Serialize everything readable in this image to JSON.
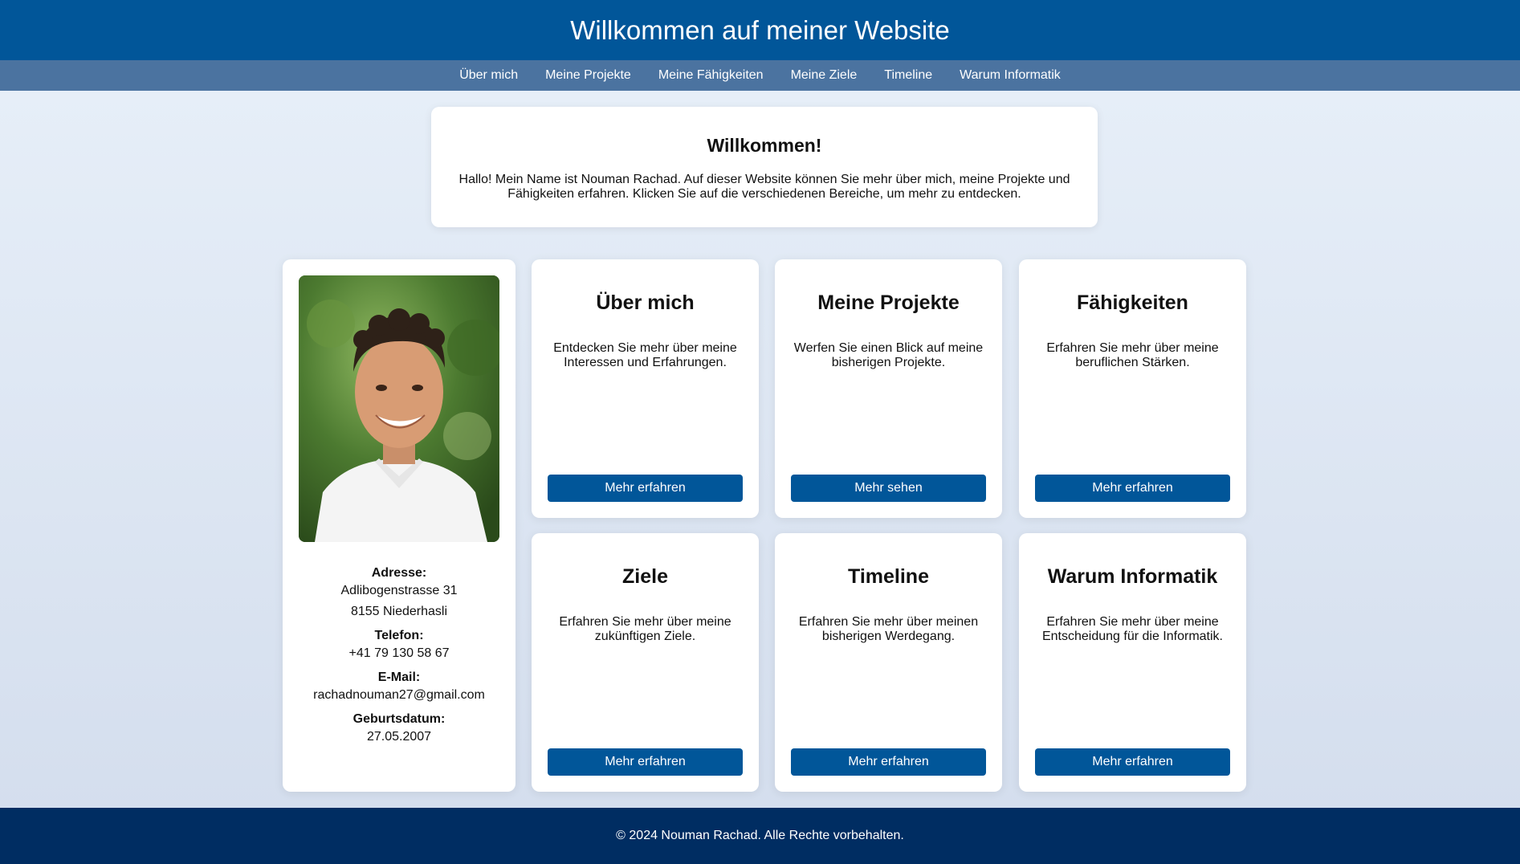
{
  "header": {
    "title": "Willkommen auf meiner Website"
  },
  "nav": {
    "items": [
      {
        "label": "Über mich"
      },
      {
        "label": "Meine Projekte"
      },
      {
        "label": "Meine Fähigkeiten"
      },
      {
        "label": "Meine Ziele"
      },
      {
        "label": "Timeline"
      },
      {
        "label": "Warum Informatik"
      }
    ]
  },
  "welcome": {
    "title": "Willkommen!",
    "text": "Hallo! Mein Name ist Nouman Rachad. Auf dieser Website können Sie mehr über mich, meine Projekte und Fähigkeiten erfahren. Klicken Sie auf die verschiedenen Bereiche, um mehr zu entdecken."
  },
  "profile": {
    "address_label": "Adresse:",
    "address_line1": "Adlibogenstrasse 31",
    "address_line2": "8155 Niederhasli",
    "phone_label": "Telefon:",
    "phone": "+41 79 130 58 67",
    "email_label": "E-Mail:",
    "email": "rachadnouman27@gmail.com",
    "birth_label": "Geburtsdatum:",
    "birth": "27.05.2007"
  },
  "tiles": [
    {
      "title": "Über mich",
      "text": "Entdecken Sie mehr über meine Interessen und Erfahrungen.",
      "button": "Mehr erfahren"
    },
    {
      "title": "Meine Projekte",
      "text": "Werfen Sie einen Blick auf meine bisherigen Projekte.",
      "button": "Mehr sehen"
    },
    {
      "title": "Fähigkeiten",
      "text": "Erfahren Sie mehr über meine beruflichen Stärken.",
      "button": "Mehr erfahren"
    },
    {
      "title": "Ziele",
      "text": "Erfahren Sie mehr über meine zukünftigen Ziele.",
      "button": "Mehr erfahren"
    },
    {
      "title": "Timeline",
      "text": "Erfahren Sie mehr über meinen bisherigen Werdegang.",
      "button": "Mehr erfahren"
    },
    {
      "title": "Warum Informatik",
      "text": "Erfahren Sie mehr über meine Entscheidung für die Informatik.",
      "button": "Mehr erfahren"
    }
  ],
  "footer": {
    "text": "© 2024 Nouman Rachad. Alle Rechte vorbehalten."
  },
  "colors": {
    "header": "#015699",
    "nav": "#4b73a0",
    "footer": "#002d62",
    "button": "#015699"
  }
}
